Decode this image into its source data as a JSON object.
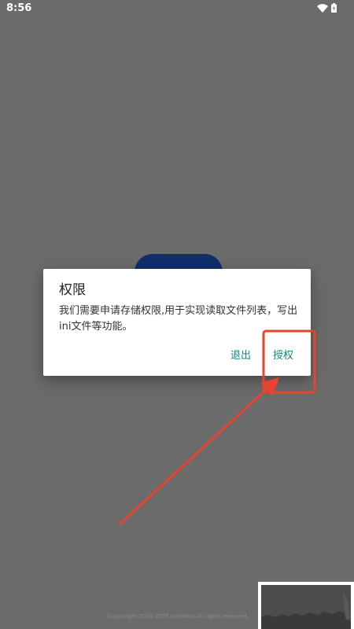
{
  "status_bar": {
    "time": "8:56",
    "icons": [
      "wifi-icon",
      "battery-icon"
    ]
  },
  "dialog": {
    "title": "权限",
    "message": "我们需要申请存储权限,用于实现读取文件列表，写出ini文件等功能。",
    "buttons": {
      "exit_label": "退出",
      "authorize_label": "授权"
    }
  },
  "footer": {
    "copyright": "©copyright 2020-2025 coldmint All rights reserved."
  },
  "colors": {
    "overlay_background": "#6b6b6b",
    "dialog_background": "#ffffff",
    "button_accent": "#0f8a7f",
    "annotation": "#e8432e",
    "background_button": "#0e2f6a"
  }
}
